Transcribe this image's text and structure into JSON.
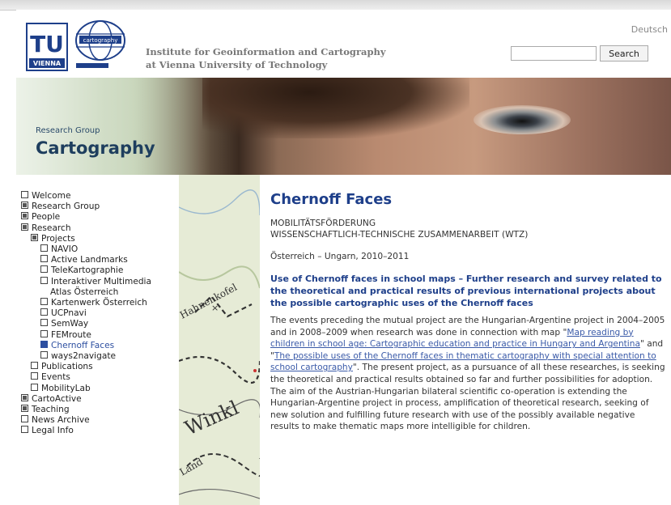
{
  "header": {
    "institute_line1": "Institute for Geoinformation and Cartography",
    "institute_line2": "at Vienna University of Technology",
    "language_link": "Deutsch",
    "search_placeholder": "",
    "search_button": "Search",
    "logo_tu_top": "TU",
    "logo_tu_bottom": "VIENNA",
    "logo_globe_label": "cartography"
  },
  "banner": {
    "small": "Research Group",
    "big": "Cartography"
  },
  "nav": {
    "items": [
      {
        "label": "Welcome",
        "level": 1,
        "type": "page"
      },
      {
        "label": "Research Group",
        "level": 1,
        "type": "folder"
      },
      {
        "label": "People",
        "level": 1,
        "type": "folder"
      },
      {
        "label": "Research",
        "level": 1,
        "type": "folder"
      },
      {
        "label": "Projects",
        "level": 2,
        "type": "folder"
      },
      {
        "label": "NAVIO",
        "level": 3,
        "type": "page"
      },
      {
        "label": "Active Landmarks",
        "level": 3,
        "type": "page"
      },
      {
        "label": "TeleKartographie",
        "level": 3,
        "type": "page"
      },
      {
        "label": "Interaktiver Multimedia",
        "level": 3,
        "type": "page"
      },
      {
        "label": "Atlas Österreich",
        "level": 3,
        "type": "continuation"
      },
      {
        "label": "Kartenwerk Österreich",
        "level": 3,
        "type": "page"
      },
      {
        "label": "UCPnavi",
        "level": 3,
        "type": "page"
      },
      {
        "label": "SemWay",
        "level": 3,
        "type": "page"
      },
      {
        "label": "FEMroute",
        "level": 3,
        "type": "page"
      },
      {
        "label": "Chernoff Faces",
        "level": 3,
        "type": "current"
      },
      {
        "label": "ways2navigate",
        "level": 3,
        "type": "page"
      },
      {
        "label": "Publications",
        "level": 2,
        "type": "page"
      },
      {
        "label": "Events",
        "level": 2,
        "type": "page"
      },
      {
        "label": "MobilityLab",
        "level": 2,
        "type": "page"
      },
      {
        "label": "CartoActive",
        "level": 1,
        "type": "folder"
      },
      {
        "label": "Teaching",
        "level": 1,
        "type": "folder"
      },
      {
        "label": "News Archive",
        "level": 1,
        "type": "page"
      },
      {
        "label": "Legal Info",
        "level": 1,
        "type": "page"
      }
    ]
  },
  "map_labels": {
    "a": "Hahnenkofel",
    "b": "Winkl",
    "c": "Land"
  },
  "content": {
    "title": "Chernoff Faces",
    "line1": "MOBILITÄTSFÖRDERUNG",
    "line2": "WISSENSCHAFTLICH-TECHNISCHE ZUSAMMENARBEIT (WTZ)",
    "line3": "Österreich – Ungarn, 2010–2011",
    "subtitle": "Use of Chernoff faces in school maps – Further research and survey related to the theoretical and practical results of previous international projects about the possible cartographic uses of the Chernoff faces",
    "para_before_link1": "The events preceding the mutual project are the Hungarian-Argentine project in 2004–2005 and in 2008–2009 when research was done in connection with map \"",
    "link1": "Map reading by children in school age: Cartographic education and practice in Hungary and Argentina",
    "para_between": "\" and \"",
    "link2": "The possible uses of the Chernoff faces in thematic cartography with special attention to school cartography",
    "para_after": "\". The present project, as a pursuance of all these researches, is seeking the theoretical and practical results obtained so far and further possibilities for adoption. The aim of the Austrian-Hungarian bilateral scientific co-operation is extending the Hungarian-Argentine project in process, amplification of theoretical research, seeking of new solution and fulfilling future research with use of the possibly available negative results to make thematic maps more intelligible for children."
  }
}
